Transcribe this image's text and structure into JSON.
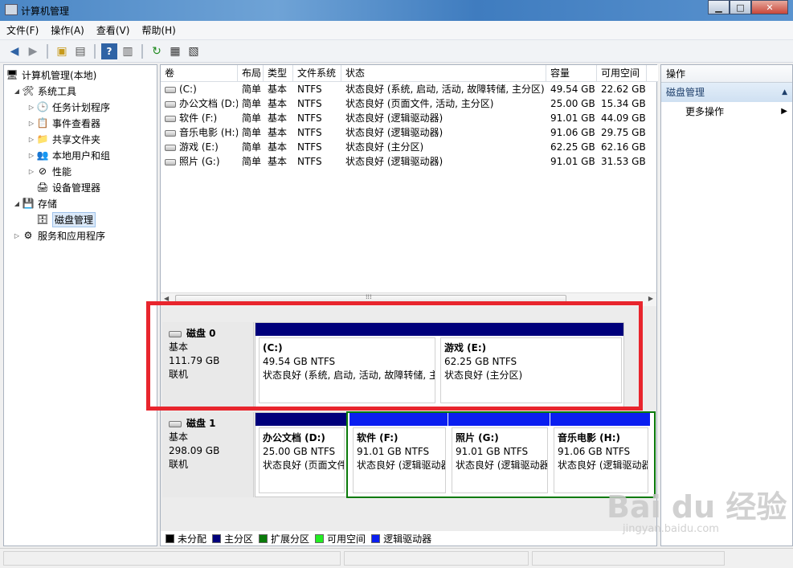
{
  "window": {
    "title": "计算机管理"
  },
  "window_buttons": {
    "minimize": "▁",
    "maximize": "□",
    "close": "✕"
  },
  "menu": [
    "文件(F)",
    "操作(A)",
    "查看(V)",
    "帮助(H)"
  ],
  "toolbar": [
    "back-icon",
    "forward-icon",
    "up-folder-icon",
    "show-tree-icon",
    "help-icon",
    "panel-icon",
    "refresh-icon",
    "properties-icon",
    "export-icon"
  ],
  "tree": {
    "root": "计算机管理(本地)",
    "system_tools": "系统工具",
    "task_scheduler": "任务计划程序",
    "event_viewer": "事件查看器",
    "shared_folders": "共享文件夹",
    "local_users": "本地用户和组",
    "performance": "性能",
    "device_manager": "设备管理器",
    "storage": "存储",
    "disk_management": "磁盘管理",
    "services": "服务和应用程序"
  },
  "volumes": {
    "headers": [
      "卷",
      "布局",
      "类型",
      "文件系统",
      "状态",
      "容量",
      "可用空间"
    ],
    "rows": [
      [
        "(C:)",
        "简单",
        "基本",
        "NTFS",
        "状态良好 (系统, 启动, 活动, 故障转储, 主分区)",
        "49.54 GB",
        "22.62 GB"
      ],
      [
        "办公文档 (D:)",
        "简单",
        "基本",
        "NTFS",
        "状态良好 (页面文件, 活动, 主分区)",
        "25.00 GB",
        "15.34 GB"
      ],
      [
        "软件 (F:)",
        "简单",
        "基本",
        "NTFS",
        "状态良好 (逻辑驱动器)",
        "91.01 GB",
        "44.09 GB"
      ],
      [
        "音乐电影 (H:)",
        "简单",
        "基本",
        "NTFS",
        "状态良好 (逻辑驱动器)",
        "91.06 GB",
        "29.75 GB"
      ],
      [
        "游戏 (E:)",
        "简单",
        "基本",
        "NTFS",
        "状态良好 (主分区)",
        "62.25 GB",
        "62.16 GB"
      ],
      [
        "照片 (G:)",
        "简单",
        "基本",
        "NTFS",
        "状态良好 (逻辑驱动器)",
        "91.01 GB",
        "31.53 GB"
      ]
    ]
  },
  "disks": [
    {
      "name": "磁盘 0",
      "type": "基本",
      "size": "111.79 GB",
      "status": "联机",
      "partitions": [
        {
          "name": "(C:)",
          "size": "49.54 GB NTFS",
          "status": "状态良好 (系统, 启动, 活动, 故障转储, 主分区)"
        },
        {
          "name": "游戏  (E:)",
          "size": "62.25 GB NTFS",
          "status": "状态良好 (主分区)"
        }
      ]
    },
    {
      "name": "磁盘 1",
      "type": "基本",
      "size": "298.09 GB",
      "status": "联机",
      "partitions": [
        {
          "name": "办公文档  (D:)",
          "size": "25.00 GB NTFS",
          "status": "状态良好 (页面文件, 活动, 主分区)"
        },
        {
          "name": "软件  (F:)",
          "size": "91.01 GB NTFS",
          "status": "状态良好 (逻辑驱动器)"
        },
        {
          "name": "照片  (G:)",
          "size": "91.01 GB NTFS",
          "status": "状态良好 (逻辑驱动器)"
        },
        {
          "name": "音乐电影  (H:)",
          "size": "91.06 GB NTFS",
          "status": "状态良好 (逻辑驱动器)"
        }
      ]
    }
  ],
  "legend": [
    {
      "label": "未分配",
      "color": "#000000"
    },
    {
      "label": "主分区",
      "color": "#00007b"
    },
    {
      "label": "扩展分区",
      "color": "#0a7a0a"
    },
    {
      "label": "可用空间",
      "color": "#22ee22"
    },
    {
      "label": "逻辑驱动器",
      "color": "#0a1ef0"
    }
  ],
  "actions": {
    "header": "操作",
    "section": "磁盘管理",
    "more": "更多操作"
  },
  "watermark": {
    "main": "Bai du 经验",
    "sub": "jingyan.baidu.com"
  }
}
